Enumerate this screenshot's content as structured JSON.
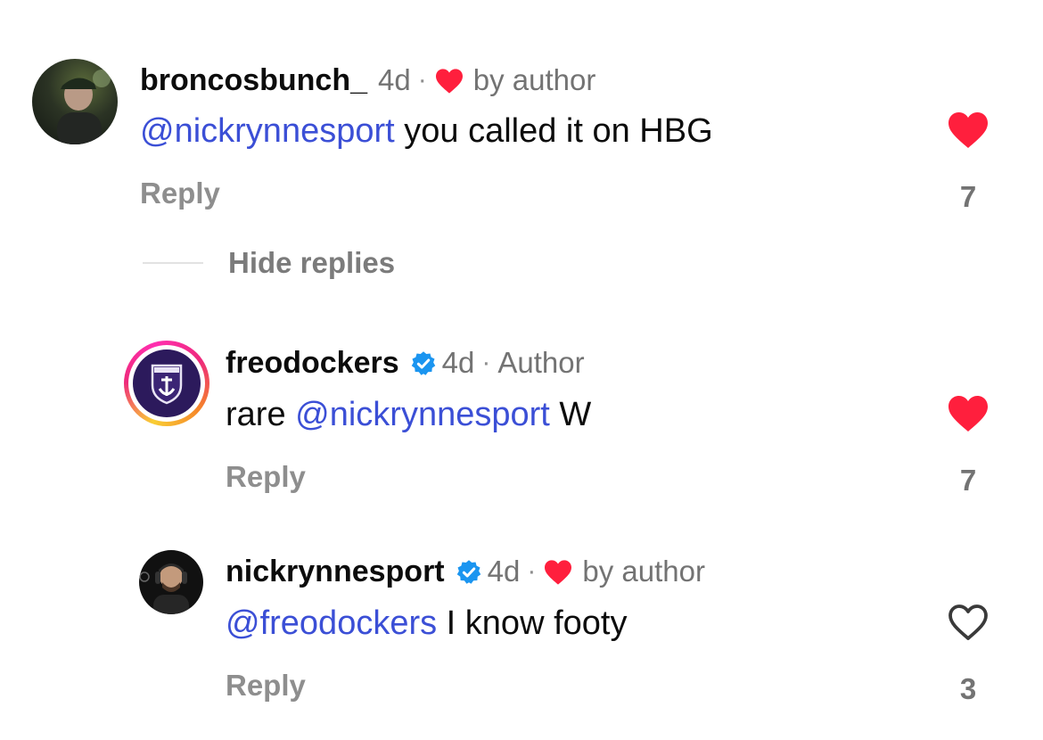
{
  "colors": {
    "mention": "#3b4fd6",
    "liked_heart": "#ff1f3d",
    "muted_text": "#737373",
    "verified": "#1b95f0"
  },
  "comments": [
    {
      "username": "broncosbunch_",
      "age": "4d",
      "separator": "·",
      "badge_text": "by author",
      "mention": "@nickrynnesport",
      "text": " you called it on HBG",
      "reply_label": "Reply",
      "like_count": "7",
      "liked": true
    }
  ],
  "hide_replies_label": "Hide replies",
  "replies": [
    {
      "username": "freodockers",
      "age": "4d",
      "separator": "·",
      "role": "Author",
      "text_before": "rare ",
      "mention": "@nickrynnesport",
      "text_after": " W",
      "reply_label": "Reply",
      "like_count": "7",
      "liked": true,
      "verified": true
    },
    {
      "username": "nickrynnesport",
      "age": "4d",
      "separator": "·",
      "badge_text": "by author",
      "mention": "@freodockers",
      "text": " I know footy",
      "reply_label": "Reply",
      "like_count": "3",
      "liked": false,
      "verified": true
    }
  ]
}
